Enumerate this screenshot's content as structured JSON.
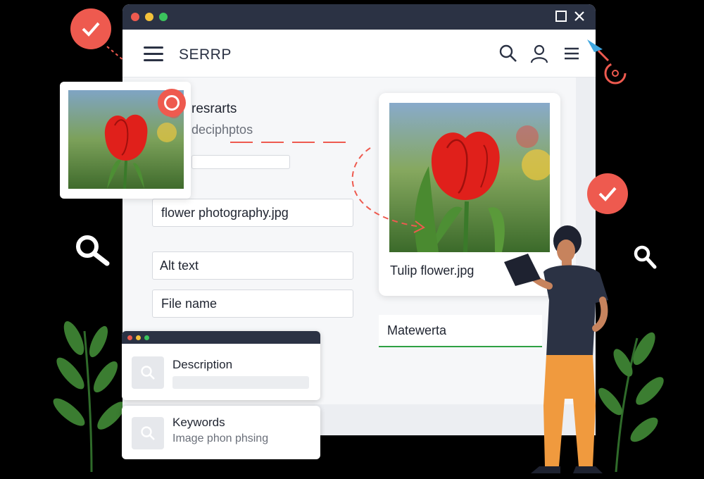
{
  "app": {
    "title": "SERRP"
  },
  "left_panel": {
    "heading": "resrarts",
    "subheading": "deciphptos",
    "filename_value": "flower photography.jpg",
    "alt_text_label": "Alt text",
    "file_name_label": "File name"
  },
  "preview": {
    "caption": "Tulip flower.jpg"
  },
  "right_field": {
    "value": "Matewerta"
  },
  "mini_panel": {
    "description_label": "Description",
    "keywords_label": "Keywords",
    "keywords_hint": "Image phon phsing"
  },
  "icons": [
    "menu-icon",
    "search-icon",
    "user-icon",
    "list-icon",
    "check-icon",
    "magnifier-icon",
    "leaf-icon",
    "cursor-icon"
  ],
  "colors": {
    "accent": "#ee5a4f",
    "titlebar": "#2b3244",
    "success_line": "#2ea043"
  }
}
